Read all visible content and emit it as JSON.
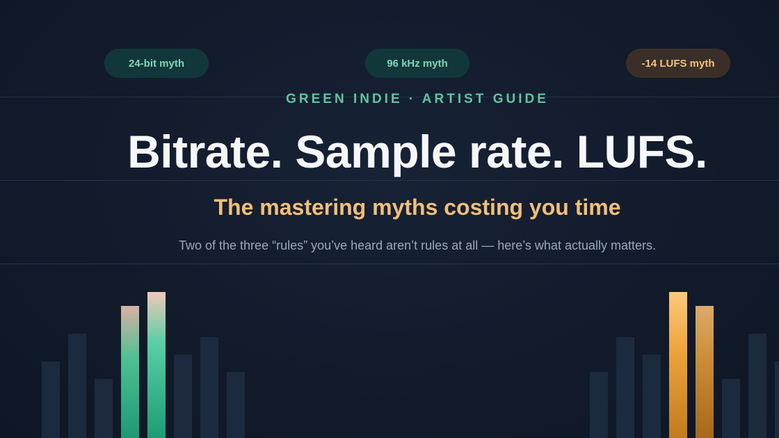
{
  "pills": [
    {
      "label": "24-bit myth"
    },
    {
      "label": "96 kHz myth"
    },
    {
      "label": "-14 LUFS myth"
    }
  ],
  "hero": {
    "eyebrow": "GREEN INDIE · ARTIST GUIDE",
    "title": "Bitrate. Sample rate. LUFS.",
    "subtitle": "The mastering myths costing you time",
    "description": "Two of the three “rules” you’ve heard aren’t rules at all — here’s what actually matters."
  },
  "colors": {
    "background": "#121b2b",
    "accent_green": "#5fc79c",
    "accent_amber": "#f1bf7a",
    "title": "#f6f7f9",
    "muted_text": "#9aa8bb"
  }
}
